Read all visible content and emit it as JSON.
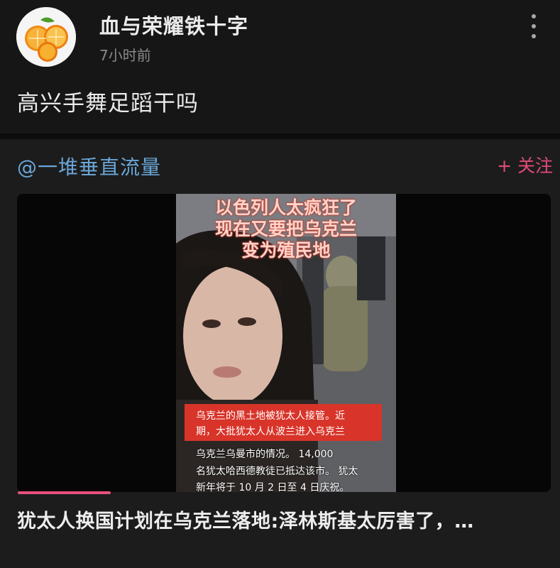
{
  "post": {
    "author": "血与荣耀铁十字",
    "time": "7小时前",
    "text": "高兴手舞足蹈干吗",
    "avatar_icon": "orange-slices-icon",
    "more_icon": "vertical-ellipsis-icon"
  },
  "repost": {
    "author": "@一堆垂直流量",
    "follow_label": "+ 关注",
    "video": {
      "caption_lines": [
        "以色列人太疯狂了",
        "现在又要把乌克兰",
        "变为殖民地"
      ],
      "red_lines": [
        "乌克兰的黑土地被犹太人接管。近",
        "期，大批犹太人从波兰进入乌克兰"
      ],
      "sub_lines": [
        "乌克兰乌曼市的情况。 14,000",
        "名犹太哈西德教徒已抵达该市。 犹太",
        "新年将于 10 月 2 日至 4 日庆祝。"
      ],
      "progress": 0.17
    },
    "title": "犹太人换国计划在乌克兰落地:泽林斯基太厉害了，…"
  },
  "colors": {
    "accent_link": "#6aa6d8",
    "follow": "#e04a78",
    "progress": "#e8517e",
    "caption_red": "#d8342a"
  }
}
